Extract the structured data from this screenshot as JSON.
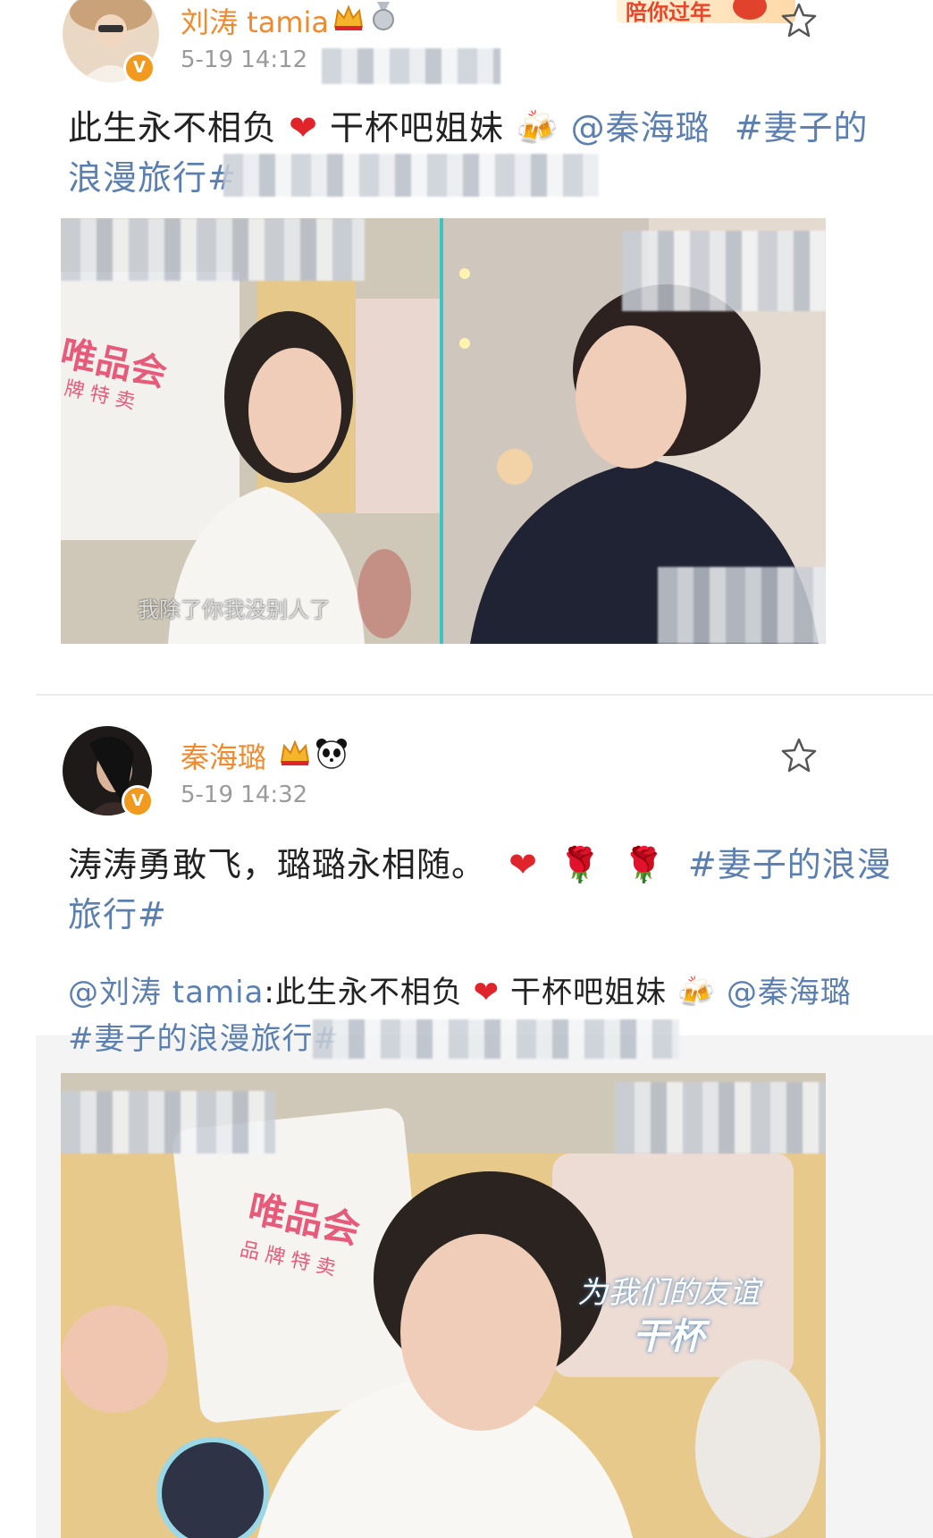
{
  "post1": {
    "author": "刘涛 tamia",
    "time": "5-19 14:12",
    "banner": "陪你过年",
    "text_line1": "此生永不相负",
    "text_line1b": "干杯吧姐妹",
    "mention": "@秦海璐",
    "hashtag_start": "#妻子的",
    "text_line2": "浪漫旅行#",
    "subtitle": "我除了你我没别人了",
    "pillow_brand": "唯品会",
    "pillow_sub": "牌 特 卖"
  },
  "post2": {
    "author": "秦海璐",
    "time": "5-19 14:32",
    "text_line1": "涛涛勇敢飞，璐璐永相随。",
    "hashtag": "#妻子的浪漫",
    "text_line2": "旅行#",
    "repost": {
      "author_mention": "@刘涛 tamia",
      "text": ":此生永不相负",
      "text_b": "干杯吧姐妹",
      "mention": "@秦海璐",
      "hashtag": "#妻子的浪漫旅行#",
      "pillow_brand": "唯品会",
      "pillow_sub": "品 牌 特 卖",
      "caption_line1": "为我们的友谊",
      "caption_line2": "干杯"
    }
  },
  "colors": {
    "name_orange": "#f08a2c",
    "link_blue": "#5b7fb0",
    "time_gray": "#9a9a9a",
    "heart_red": "#e0242c"
  },
  "icons": [
    "star-icon",
    "crown-icon",
    "medal-icon",
    "panda-icon",
    "heart-icon",
    "beer-icon",
    "rose-icon",
    "verified-icon"
  ]
}
